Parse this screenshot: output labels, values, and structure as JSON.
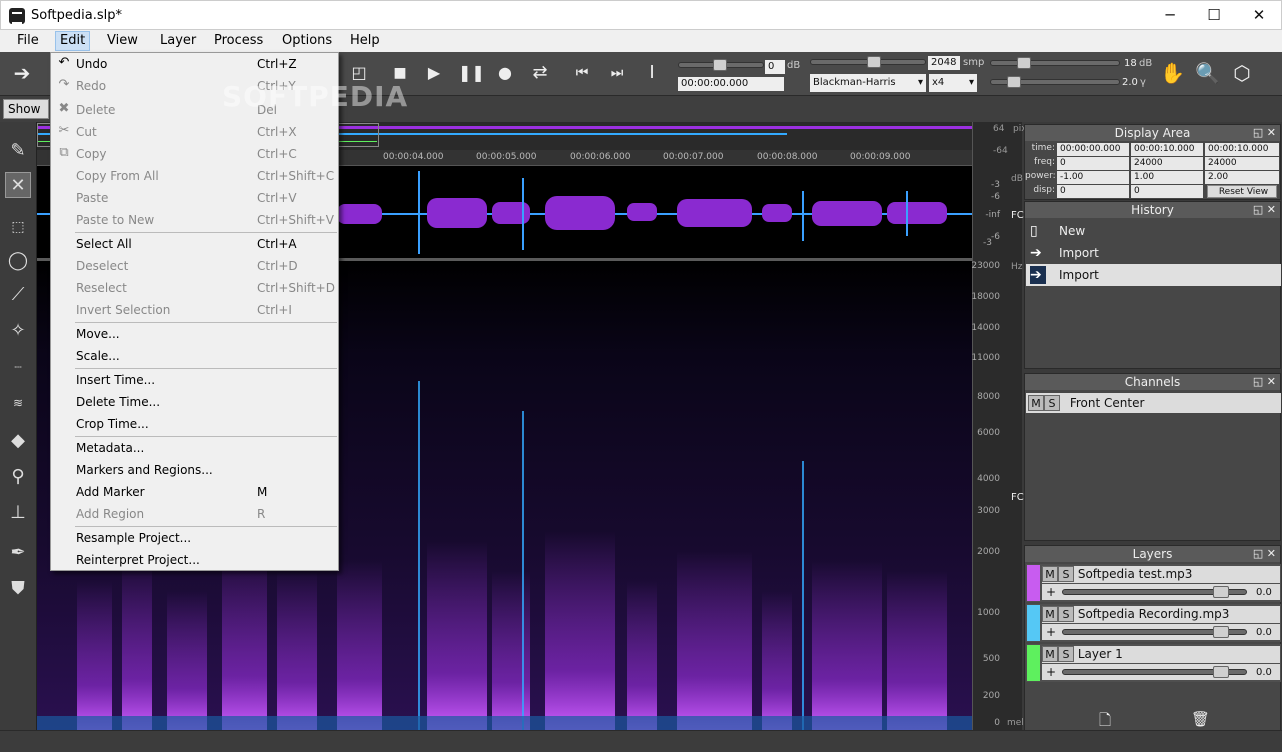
{
  "window": {
    "title": "Softpedia.slp*",
    "controls": [
      "─",
      "☐",
      "✕"
    ]
  },
  "menubar": {
    "items": [
      "File",
      "Edit",
      "View",
      "Layer",
      "Process",
      "Options",
      "Help"
    ]
  },
  "toolbar": {
    "db1_value": "0",
    "db1_unit": "dB",
    "time_value": "00:00:00.000",
    "fft_size": "2048",
    "fft_unit": "smp",
    "window_fn": "Blackman-Harris",
    "oversample": "x4",
    "gain_value": "18",
    "gain_unit": "dB",
    "gamma_value": "2.0",
    "gamma_unit": "γ"
  },
  "strip": {
    "show_button": "Show G"
  },
  "watermark": "SOFTPEDIA",
  "edit_menu": {
    "items": [
      {
        "label": "Undo",
        "shortcut": "Ctrl+Z",
        "enabled": true,
        "icon": "undo-icon"
      },
      {
        "label": "Redo",
        "shortcut": "Ctrl+Y",
        "enabled": false,
        "icon": "redo-icon"
      },
      {
        "label": "Delete",
        "shortcut": "Del",
        "enabled": false,
        "icon": "delete-icon"
      },
      {
        "label": "Cut",
        "shortcut": "Ctrl+X",
        "enabled": false,
        "icon": "cut-icon"
      },
      {
        "label": "Copy",
        "shortcut": "Ctrl+C",
        "enabled": false,
        "icon": "copy-icon"
      },
      {
        "label": "Copy From All",
        "shortcut": "Ctrl+Shift+C",
        "enabled": false
      },
      {
        "label": "Paste",
        "shortcut": "Ctrl+V",
        "enabled": false
      },
      {
        "label": "Paste to New",
        "shortcut": "Ctrl+Shift+V",
        "enabled": false
      },
      {
        "label": "Select All",
        "shortcut": "Ctrl+A",
        "enabled": true
      },
      {
        "label": "Deselect",
        "shortcut": "Ctrl+D",
        "enabled": false
      },
      {
        "label": "Reselect",
        "shortcut": "Ctrl+Shift+D",
        "enabled": false
      },
      {
        "label": "Invert Selection",
        "shortcut": "Ctrl+I",
        "enabled": false
      },
      {
        "label": "Move...",
        "shortcut": "",
        "enabled": true
      },
      {
        "label": "Scale...",
        "shortcut": "",
        "enabled": true
      },
      {
        "label": "Insert Time...",
        "shortcut": "",
        "enabled": true
      },
      {
        "label": "Delete Time...",
        "shortcut": "",
        "enabled": true
      },
      {
        "label": "Crop Time...",
        "shortcut": "",
        "enabled": true
      },
      {
        "label": "Metadata...",
        "shortcut": "",
        "enabled": true
      },
      {
        "label": "Markers and Regions...",
        "shortcut": "",
        "enabled": true
      },
      {
        "label": "Add Marker",
        "shortcut": "M",
        "enabled": true
      },
      {
        "label": "Add Region",
        "shortcut": "R",
        "enabled": false
      },
      {
        "label": "Resample Project...",
        "shortcut": "",
        "enabled": true
      },
      {
        "label": "Reinterpret Project...",
        "shortcut": "",
        "enabled": true
      }
    ]
  },
  "timeline": {
    "ticks": [
      "00:00:04.000",
      "00:00:05.000",
      "00:00:06.000",
      "00:00:07.000",
      "00:00:08.000",
      "00:00:09.000"
    ],
    "unit": "hms"
  },
  "freq_ruler": {
    "labels": [
      "23000",
      "18000",
      "14000",
      "11000",
      "8000",
      "6000",
      "4000",
      "3000",
      "2000",
      "1000",
      "500",
      "200",
      "0"
    ],
    "unit_hz": "Hz",
    "unit_mel": "mel",
    "unit_db": "dB",
    "unit_pix": "pix",
    "channel_label": "FC",
    "wave_labels": [
      "-3",
      "-6",
      "-inf",
      "-6",
      "-3"
    ],
    "top_labels": [
      "64",
      "-64"
    ]
  },
  "display_area": {
    "title": "Display Area",
    "rows": [
      {
        "label": "time:",
        "a": "00:00:00.000",
        "b": "00:00:10.000",
        "c": "00:00:10.000"
      },
      {
        "label": "freq:",
        "a": "0",
        "b": "24000",
        "c": "24000"
      },
      {
        "label": "power:",
        "a": "-1.00",
        "b": "1.00",
        "c": "2.00"
      },
      {
        "label": "disp:",
        "a": "0",
        "b": "0",
        "c": "Reset View"
      }
    ]
  },
  "history": {
    "title": "History",
    "items": [
      {
        "label": "New",
        "icon": "new-file-icon"
      },
      {
        "label": "Import",
        "icon": "import-icon"
      },
      {
        "label": "Import",
        "icon": "import-icon"
      }
    ]
  },
  "channels": {
    "title": "Channels",
    "m": "M",
    "s": "S",
    "items": [
      "Front Center"
    ]
  },
  "layers": {
    "title": "Layers",
    "m": "M",
    "s": "S",
    "plus": "+",
    "items": [
      {
        "name": "Softpedia test.mp3",
        "value": "0.0",
        "color": "#c85cf0"
      },
      {
        "name": "Softpedia Recording.mp3",
        "value": "0.0",
        "color": "#55c8f5"
      },
      {
        "name": "Layer 1",
        "value": "0.0",
        "color": "#5ef05e"
      }
    ]
  },
  "colors": {
    "purple": "#9b30e0",
    "cyan": "#33aaff"
  }
}
